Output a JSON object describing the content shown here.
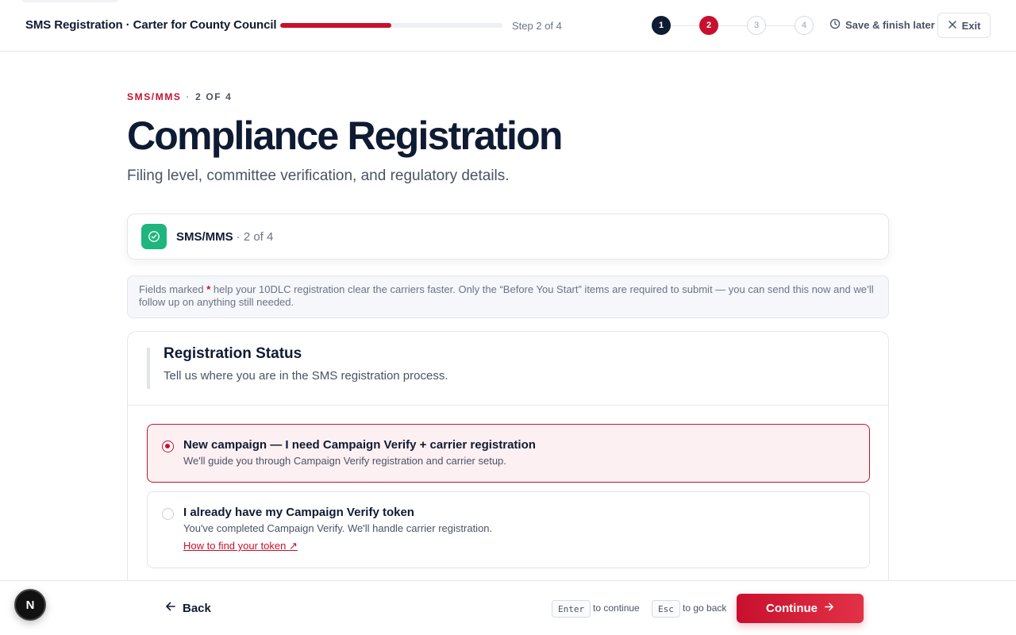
{
  "header": {
    "app_title": "SMS Registration · Carter for County Council",
    "progress_percent": 50,
    "step_text": "Step 2 of 4",
    "steps": [
      {
        "label": "1",
        "state": "done"
      },
      {
        "label": "2",
        "state": "active"
      },
      {
        "label": "3",
        "state": "pending"
      },
      {
        "label": "4",
        "state": "pending"
      }
    ],
    "save_later_label": "Save & finish later",
    "exit_label": "Exit"
  },
  "page": {
    "eyebrow_tag": "SMS/MMS",
    "eyebrow_sep": "·",
    "eyebrow_step": "2 OF 4",
    "title": "Compliance Registration",
    "subtitle": "Filing level, committee verification, and regulatory details."
  },
  "section": {
    "label": "SMS/MMS",
    "count": "· 2 of 4",
    "icon": "check-circle-icon"
  },
  "info": {
    "prefix": "Fields marked ",
    "star": "*",
    "text": " help your 10DLC registration clear the carriers faster. Only the “Before You Start” items are required to submit — you can send this now and we’ll follow up on anything still needed."
  },
  "status": {
    "title": "Registration Status",
    "description": "Tell us where you are in the SMS registration process.",
    "options": [
      {
        "title": "New campaign — I need Campaign Verify + carrier registration",
        "description": "We'll guide you through Campaign Verify registration and carrier setup.",
        "selected": true
      },
      {
        "title": "I already have my Campaign Verify token",
        "description": "You've completed Campaign Verify. We'll handle carrier registration.",
        "link": "How to find your token ↗",
        "selected": false
      }
    ]
  },
  "footer": {
    "back_label": "Back",
    "enter_key": "Enter",
    "enter_hint": "to continue",
    "esc_key": "Esc",
    "esc_hint": "to go back",
    "continue_label": "Continue"
  },
  "dev_badge": {
    "label": "N"
  },
  "colors": {
    "accent": "#c8102e",
    "navy": "#0f1b33",
    "success": "#1fb57e"
  }
}
